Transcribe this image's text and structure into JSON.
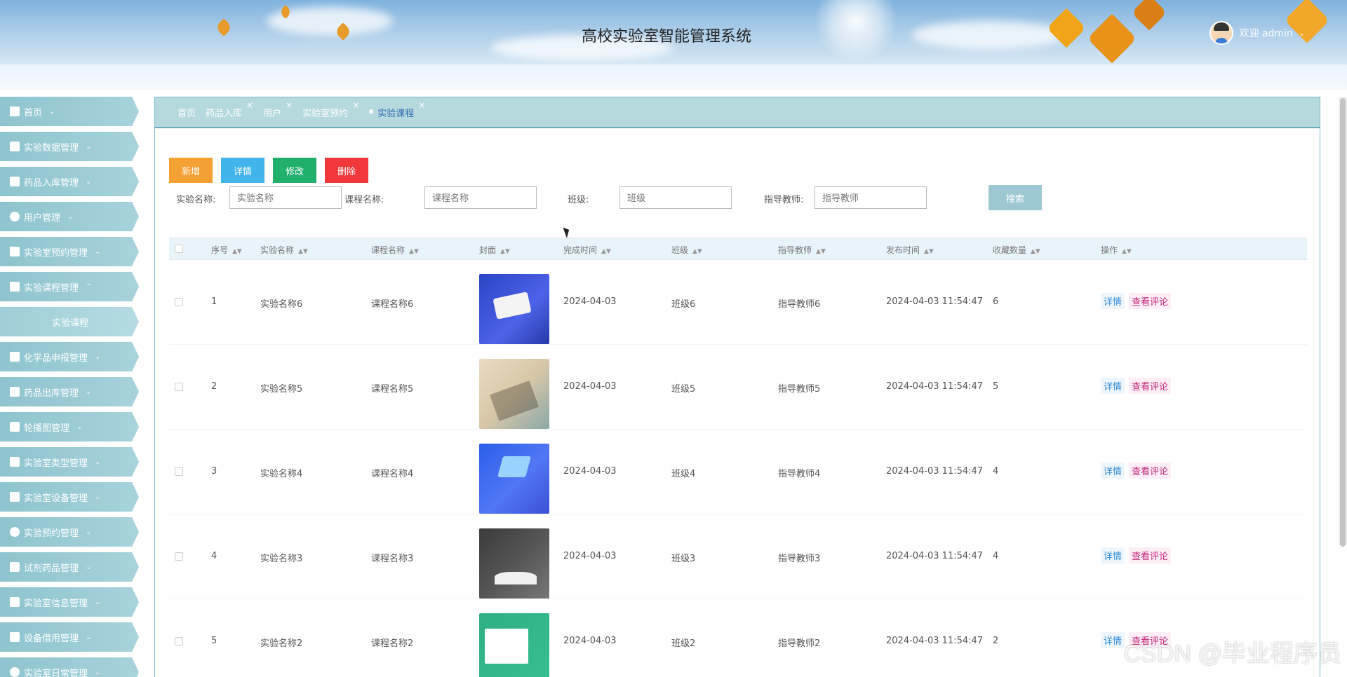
{
  "header": {
    "title": "高校实验室智能管理系统",
    "user_label": "欢迎 admin"
  },
  "sidebar": {
    "items": [
      {
        "label": "首页"
      },
      {
        "label": "实验数据管理"
      },
      {
        "label": "药品入库管理"
      },
      {
        "label": "用户管理"
      },
      {
        "label": "实验室预约管理"
      },
      {
        "label": "实验课程管理",
        "expanded": true
      },
      {
        "label": "实验课程",
        "sub": true
      },
      {
        "label": "化学品申报管理"
      },
      {
        "label": "药品出库管理"
      },
      {
        "label": "轮播图管理"
      },
      {
        "label": "实验室类型管理"
      },
      {
        "label": "实验室设备管理"
      },
      {
        "label": "实验预约管理"
      },
      {
        "label": "试剂药品管理"
      },
      {
        "label": "实验室信息管理"
      },
      {
        "label": "设备借用管理"
      },
      {
        "label": "实验室日常管理"
      }
    ]
  },
  "tabs": [
    {
      "label": "首页"
    },
    {
      "label": "药品入库"
    },
    {
      "label": "用户"
    },
    {
      "label": "实验室预约"
    },
    {
      "label": "实验课程",
      "active": true
    }
  ],
  "toolbar": {
    "add_label": "新增",
    "detail_label": "详情",
    "edit_label": "修改",
    "delete_label": "删除"
  },
  "search": {
    "experiment_label": "实验名称:",
    "experiment_placeholder": "实验名称",
    "course_label": "课程名称:",
    "course_placeholder": "课程名称",
    "class_label": "班级:",
    "class_placeholder": "班级",
    "teacher_label": "指导教师:",
    "teacher_placeholder": "指导教师",
    "search_button": "搜索"
  },
  "table": {
    "headers": [
      "序号",
      "实验名称",
      "课程名称",
      "封面",
      "完成时间",
      "班级",
      "指导教师",
      "发布时间",
      "收藏数量",
      "操作"
    ],
    "rows": [
      {
        "no": "1",
        "experiment": "实验名称6",
        "course": "课程名称6",
        "finish": "2024-04-03",
        "class": "班级6",
        "teacher": "指导教师6",
        "published": "2024-04-03 11:54:47",
        "favorites": "6"
      },
      {
        "no": "2",
        "experiment": "实验名称5",
        "course": "课程名称5",
        "finish": "2024-04-03",
        "class": "班级5",
        "teacher": "指导教师5",
        "published": "2024-04-03 11:54:47",
        "favorites": "5"
      },
      {
        "no": "3",
        "experiment": "实验名称4",
        "course": "课程名称4",
        "finish": "2024-04-03",
        "class": "班级4",
        "teacher": "指导教师4",
        "published": "2024-04-03 11:54:47",
        "favorites": "4"
      },
      {
        "no": "4",
        "experiment": "实验名称3",
        "course": "课程名称3",
        "finish": "2024-04-03",
        "class": "班级3",
        "teacher": "指导教师3",
        "published": "2024-04-03 11:54:47",
        "favorites": "4"
      },
      {
        "no": "5",
        "experiment": "实验名称2",
        "course": "课程名称2",
        "finish": "2024-04-03",
        "class": "班级2",
        "teacher": "指导教师2",
        "published": "2024-04-03 11:54:47",
        "favorites": "2"
      }
    ],
    "op_detail": "详情",
    "op_comments": "查看评论"
  },
  "watermark": "CSDN @毕业程序员",
  "colors": {
    "add": "#f5a033",
    "detail": "#41b4ec",
    "edit": "#21b06b",
    "delete": "#f0383b",
    "sidebar": "#8ec4cf",
    "tabs_bar": "#b6d9de"
  }
}
